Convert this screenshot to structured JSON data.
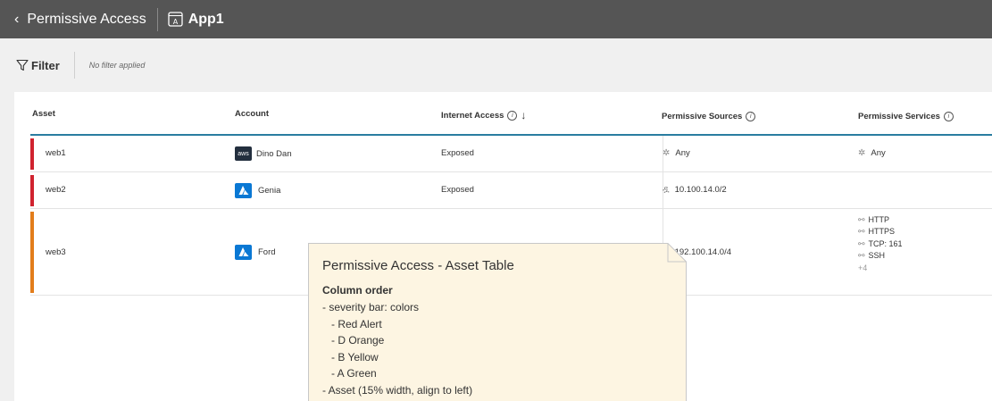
{
  "header": {
    "back_label": "Permissive Access",
    "app_name": "App1"
  },
  "filter": {
    "label": "Filter",
    "status": "No filter applied"
  },
  "table": {
    "columns": [
      "Asset",
      "Account",
      "Internet Access",
      "Permissive Sources",
      "Permissive Services"
    ],
    "rows": [
      {
        "asset": "web1",
        "severity_color": "#d0232f",
        "account": "Dino Dan",
        "account_type": "aws",
        "internet": "Exposed",
        "sources": [
          "Any"
        ],
        "services": [
          "Any"
        ]
      },
      {
        "asset": "web2",
        "severity_color": "#d0232f",
        "account": "Genia",
        "account_type": "azure",
        "internet": "Exposed",
        "sources": [
          "10.100.14.0/2"
        ],
        "services": []
      },
      {
        "asset": "web3",
        "severity_color": "#e27d1b",
        "account": "Ford",
        "account_type": "azure",
        "internet": "",
        "sources": [
          "192.100.14.0/4"
        ],
        "services": [
          "HTTP",
          "HTTPS",
          "TCP: 161",
          "SSH"
        ],
        "services_more": "+4"
      }
    ]
  },
  "tooltip": {
    "title": "Permissive Access - Asset Table",
    "subtitle": "Column order",
    "lines": [
      "- severity bar: colors",
      "   - Red Alert",
      "   - D Orange",
      "   - B Yellow",
      "   - A Green",
      "- Asset (15% width, align to left)"
    ]
  },
  "colors": {
    "accent": "#2a7da0",
    "topbar": "#555555",
    "tooltip_bg": "#fdf5e2"
  }
}
